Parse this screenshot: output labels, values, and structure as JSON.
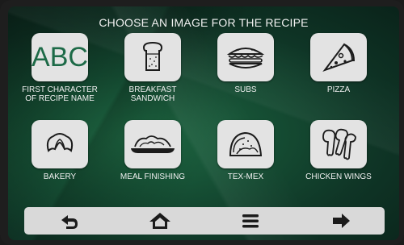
{
  "header": {
    "title": "CHOOSE AN IMAGE FOR THE RECIPE"
  },
  "tiles": [
    {
      "label": "FIRST CHARACTER OF RECIPE NAME",
      "text": "ABC",
      "icon": "abc-text-icon"
    },
    {
      "label": "BREAKFAST SANDWICH",
      "icon": "toast-icon"
    },
    {
      "label": "SUBS",
      "icon": "sub-sandwich-icon"
    },
    {
      "label": "PIZZA",
      "icon": "pizza-slice-icon"
    },
    {
      "label": "BAKERY",
      "icon": "croissant-icon"
    },
    {
      "label": "MEAL FINISHING",
      "icon": "plated-meal-icon"
    },
    {
      "label": "TEX-MEX",
      "icon": "taco-icon"
    },
    {
      "label": "CHICKEN WINGS",
      "icon": "chicken-wings-icon"
    }
  ],
  "nav": {
    "buttons": [
      "back-icon",
      "home-icon",
      "menu-icon",
      "forward-icon"
    ]
  },
  "colors": {
    "accent": "#1d6a47",
    "tile": "#e3e3e3",
    "text": "#f2f2f2"
  }
}
